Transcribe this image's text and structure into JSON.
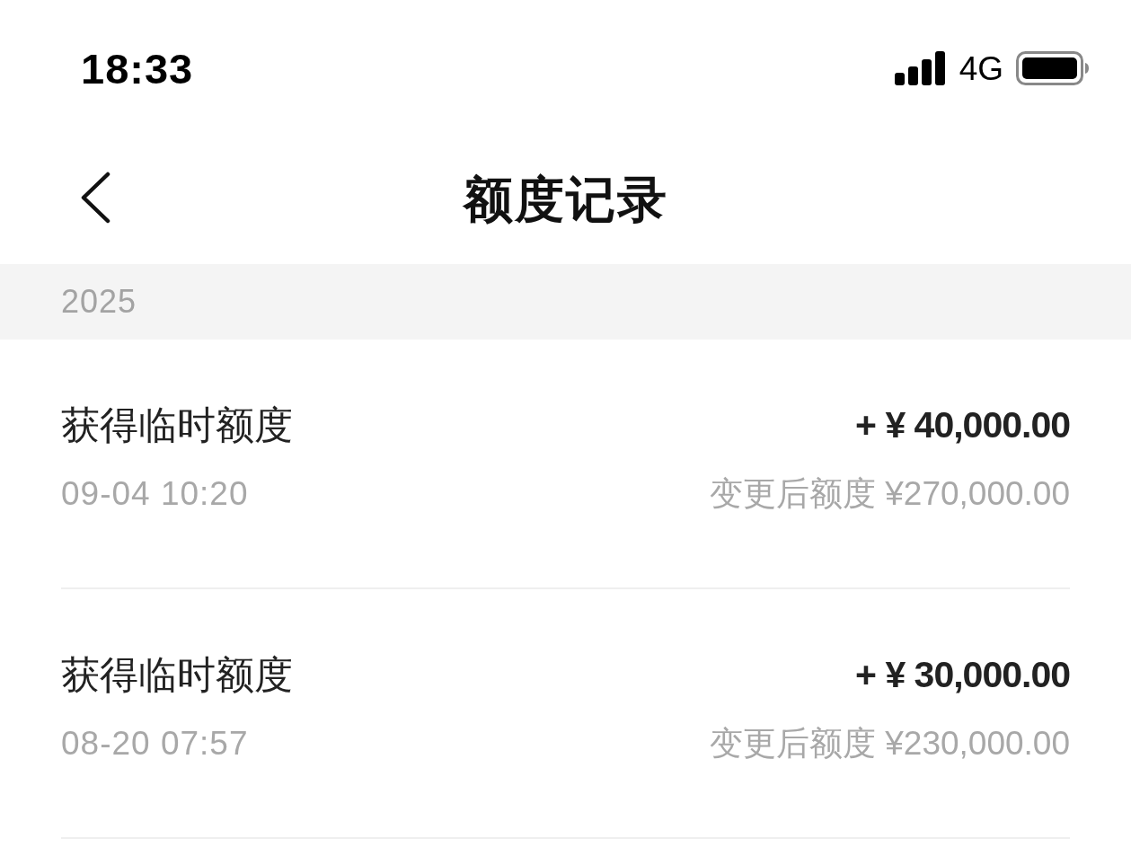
{
  "status_bar": {
    "time": "18:33",
    "network": "4G"
  },
  "nav_bar": {
    "title": "额度记录"
  },
  "sections": [
    {
      "year": "2025",
      "records": [
        {
          "title": "获得临时额度",
          "amount": "+ ¥ 40,000.00",
          "time": "09-04 10:20",
          "balance_after": "变更后额度 ¥270,000.00"
        },
        {
          "title": "获得临时额度",
          "amount": "+ ¥ 30,000.00",
          "time": "08-20 07:57",
          "balance_after": "变更后额度 ¥230,000.00"
        }
      ]
    }
  ]
}
